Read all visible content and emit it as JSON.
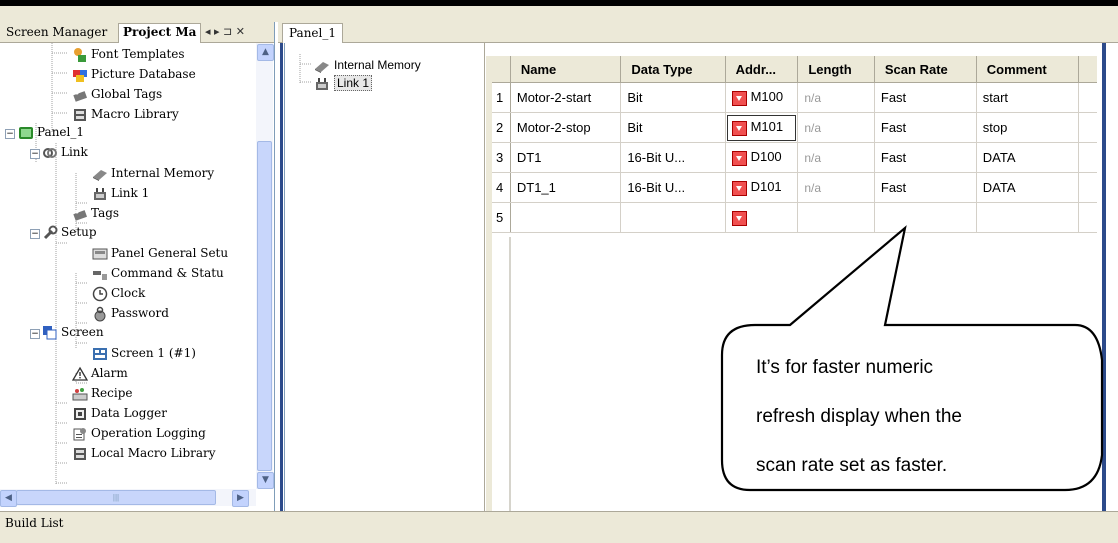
{
  "left_tabs": {
    "screen_manager": "Screen Manager",
    "project_manager": "Project Ma",
    "nav_controls": "◂ ▸ ⊐ ✕"
  },
  "tree": [
    {
      "label": "Font Templates",
      "icon": "font-templates-icon"
    },
    {
      "label": "Picture Database",
      "icon": "picture-database-icon"
    },
    {
      "label": "Global Tags",
      "icon": "tags-icon"
    },
    {
      "label": "Macro Library",
      "icon": "macro-library-icon"
    },
    {
      "label": "Panel_1",
      "icon": "panel-icon"
    },
    {
      "label": "Link",
      "icon": "link-icon"
    },
    {
      "label": "Internal Memory",
      "icon": "memory-icon"
    },
    {
      "label": "Link 1",
      "icon": "link-device-icon"
    },
    {
      "label": "Tags",
      "icon": "tags-icon"
    },
    {
      "label": "Setup",
      "icon": "setup-icon"
    },
    {
      "label": "Panel General Setu",
      "icon": "panel-setup-icon"
    },
    {
      "label": "Command & Statu",
      "icon": "command-status-icon"
    },
    {
      "label": "Clock",
      "icon": "clock-icon"
    },
    {
      "label": "Password",
      "icon": "password-icon"
    },
    {
      "label": "Screen",
      "icon": "screen-icon"
    },
    {
      "label": "Screen 1 (#1)",
      "icon": "screen-page-icon"
    },
    {
      "label": "Alarm",
      "icon": "alarm-icon"
    },
    {
      "label": "Recipe",
      "icon": "recipe-icon"
    },
    {
      "label": "Data Logger",
      "icon": "data-logger-icon"
    },
    {
      "label": "Operation Logging",
      "icon": "operation-logging-icon"
    },
    {
      "label": "Local Macro Library",
      "icon": "macro-library-icon"
    }
  ],
  "panel_tab": "Panel_1",
  "link_tree": [
    {
      "label": "Internal Memory",
      "icon": "memory-icon"
    },
    {
      "label": "Link 1",
      "icon": "link-device-icon"
    }
  ],
  "grid": {
    "columns": [
      "Name",
      "Data Type",
      "Addr...",
      "Length",
      "Scan Rate",
      "Comment"
    ],
    "rows": [
      {
        "n": "1",
        "name": "Motor-2-start",
        "type": "Bit",
        "addr": "M100",
        "length": "n/a",
        "scan": "Fast",
        "comment": "start"
      },
      {
        "n": "2",
        "name": "Motor-2-stop",
        "type": "Bit",
        "addr": "M101",
        "length": "n/a",
        "scan": "Fast",
        "comment": "stop"
      },
      {
        "n": "3",
        "name": "DT1",
        "type": "16-Bit U...",
        "addr": "D100",
        "length": "n/a",
        "scan": "Fast",
        "comment": "DATA"
      },
      {
        "n": "4",
        "name": "DT1_1",
        "type": "16-Bit U...",
        "addr": "D101",
        "length": "n/a",
        "scan": "Fast",
        "comment": "DATA"
      },
      {
        "n": "5",
        "name": "",
        "type": "",
        "addr": "",
        "length": "",
        "scan": "",
        "comment": ""
      }
    ]
  },
  "callout": {
    "line1": "It’s for faster numeric",
    "line2": "refresh display when the",
    "line3": "scan rate set as faster."
  },
  "build_list": "Build List"
}
